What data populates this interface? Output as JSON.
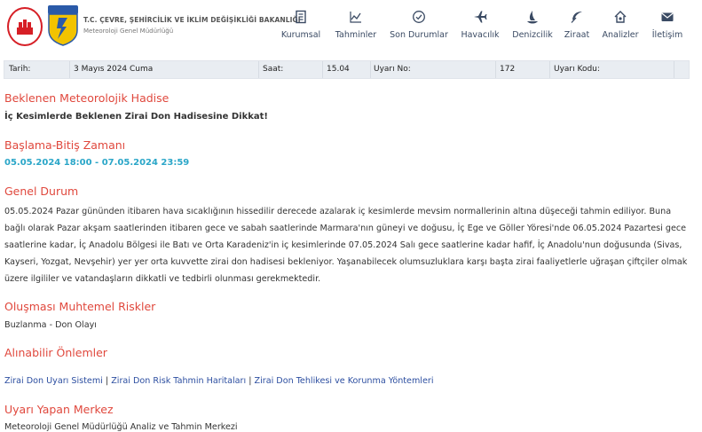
{
  "header": {
    "ministry": "T.C. ÇEVRE, ŞEHİRCİLİK VE İKLİM DEĞİŞİKLİĞİ BAKANLIĞI",
    "directorate": "Meteoroloji Genel Müdürlüğü",
    "logo_text": "METEOROLOJI"
  },
  "nav": [
    {
      "label": "Kurumsal",
      "icon": "building-icon"
    },
    {
      "label": "Tahminler",
      "icon": "line-chart-icon"
    },
    {
      "label": "Son Durumlar",
      "icon": "check-circle-icon"
    },
    {
      "label": "Havacılık",
      "icon": "airplane-icon"
    },
    {
      "label": "Denizcilik",
      "icon": "sailboat-icon"
    },
    {
      "label": "Ziraat",
      "icon": "leaf-icon"
    },
    {
      "label": "Analizler",
      "icon": "house-icon"
    },
    {
      "label": "İletişim",
      "icon": "envelope-icon"
    }
  ],
  "info": {
    "tarih_label": "Tarih:",
    "tarih_value": "3 Mayıs 2024 Cuma",
    "saat_label": "Saat:",
    "saat_value": "15.04",
    "uyari_no_label": "Uyarı No:",
    "uyari_no_value": "172",
    "uyari_kodu_label": "Uyarı Kodu:"
  },
  "sections": {
    "hadise_title": "Beklenen Meteorolojik Hadise",
    "hadise_text": "İç Kesimlerde Beklenen Zirai Don Hadisesine Dikkat!",
    "zaman_title": "Başlama-Bitiş Zamanı",
    "zaman_text": "05.05.2024 18:00 - 07.05.2024 23:59",
    "genel_title": "Genel Durum",
    "genel_text": "05.05.2024 Pazar gününden itibaren hava sıcaklığının hissedilir derecede azalarak iç kesimlerde mevsim normallerinin altına düşeceği tahmin ediliyor. Buna bağlı olarak Pazar akşam saatlerinden itibaren gece ve sabah saatlerinde Marmara'nın güneyi ve doğusu, İç Ege ve Göller Yöresi'nde 06.05.2024 Pazartesi gece saatlerine kadar, İç Anadolu Bölgesi ile Batı ve Orta Karadeniz'in iç kesimlerinde 07.05.2024 Salı gece saatlerine kadar hafif, İç Anadolu'nun doğusunda (Sivas, Kayseri, Yozgat, Nevşehir) yer yer orta kuvvette zirai don hadisesi bekleniyor. Yaşanabilecek olumsuzluklara karşı başta zirai faaliyetlerle uğraşan çiftçiler olmak üzere ilgililer ve vatandaşların dikkatli ve tedbirli olunması gerekmektedir.",
    "risk_title": "Oluşması Muhtemel Riskler",
    "risk_text": "Buzlanma - Don Olayı",
    "onlem_title": "Alınabilir Önlemler",
    "links": [
      "Zirai Don Uyarı Sistemi",
      "Zirai Don Risk Tahmin Haritaları",
      "Zirai Don Tehlikesi ve Korunma Yöntemleri"
    ],
    "link_separator": "|",
    "merkez_title": "Uyarı Yapan Merkez",
    "merkez_text": "Meteoroloji Genel Müdürlüğü Analiz ve Tahmin Merkezi"
  },
  "colors": {
    "accent_red": "#e0483d",
    "date_blue": "#2aa6c8",
    "link_blue": "#2c4ea0",
    "nav_text": "#3a4a63",
    "info_bg": "#e9edf2"
  }
}
